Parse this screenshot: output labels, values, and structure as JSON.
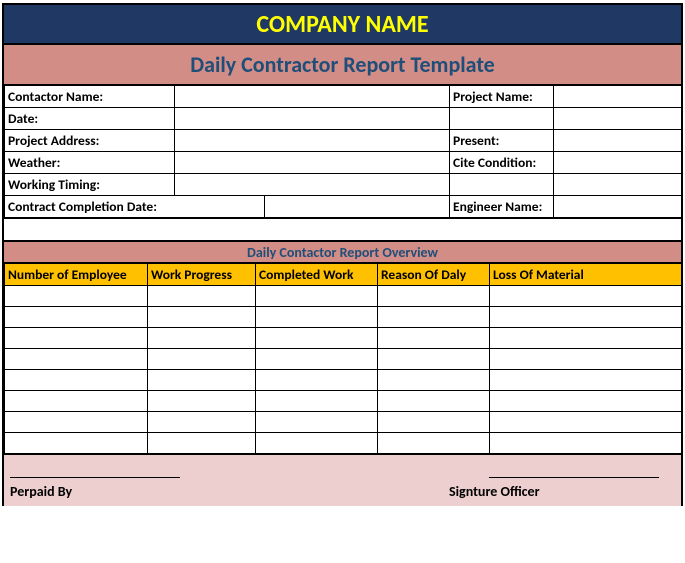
{
  "header": {
    "company": "COMPANY NAME"
  },
  "title": "Daily Contractor Report Template",
  "info": {
    "r1": {
      "l": "Contactor Name:",
      "lv": "",
      "r": "Project Name:",
      "rv": ""
    },
    "r2": {
      "l": "Date:",
      "lv": "",
      "r": "",
      "rv": ""
    },
    "r3": {
      "l": "Project Address:",
      "lv": "",
      "r": "Present:",
      "rv": ""
    },
    "r4": {
      "l": "Weather:",
      "lv": "",
      "r": "Cite Condition:",
      "rv": ""
    },
    "r5": {
      "l": "Working Timing:",
      "lv": "",
      "r": "",
      "rv": ""
    },
    "r6": {
      "l": "Contract Completion Date:",
      "lv": "",
      "r": "Engineer Name:",
      "rv": ""
    }
  },
  "overview_title": "Daily  Contactor Report Overview",
  "cols": {
    "c1": "Number of Employee",
    "c2": "Work Progress",
    "c3": "Completed Work",
    "c4": "Reason Of Daly",
    "c5": "Loss Of Material"
  },
  "sig": {
    "left": "Perpaid By",
    "right": "Signture Officer"
  }
}
